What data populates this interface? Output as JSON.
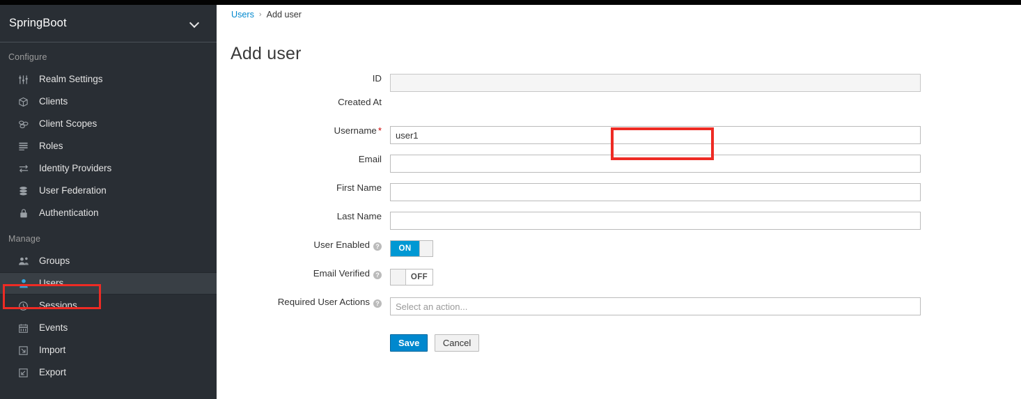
{
  "topbar": {
    "present": true
  },
  "sidebar": {
    "realm_name": "SpringBoot",
    "chevron_icon": "chevron-down-icon",
    "sections": [
      {
        "title": "Configure",
        "items": [
          {
            "label": "Realm Settings",
            "icon": "sliders-icon",
            "selected": false
          },
          {
            "label": "Clients",
            "icon": "cube-icon",
            "selected": false
          },
          {
            "label": "Client Scopes",
            "icon": "scopes-icon",
            "selected": false
          },
          {
            "label": "Roles",
            "icon": "list-icon",
            "selected": false
          },
          {
            "label": "Identity Providers",
            "icon": "exchange-arrows-icon",
            "selected": false
          },
          {
            "label": "User Federation",
            "icon": "database-icon",
            "selected": false
          },
          {
            "label": "Authentication",
            "icon": "lock-icon",
            "selected": false
          }
        ]
      },
      {
        "title": "Manage",
        "items": [
          {
            "label": "Groups",
            "icon": "users-group-icon",
            "selected": false
          },
          {
            "label": "Users",
            "icon": "user-icon",
            "selected": true
          },
          {
            "label": "Sessions",
            "icon": "clock-icon",
            "selected": false
          },
          {
            "label": "Events",
            "icon": "calendar-icon",
            "selected": false
          },
          {
            "label": "Import",
            "icon": "import-arrow-icon",
            "selected": false
          },
          {
            "label": "Export",
            "icon": "export-arrow-icon",
            "selected": false
          }
        ]
      }
    ]
  },
  "breadcrumb": {
    "parent": "Users",
    "separator": "›",
    "current": "Add user"
  },
  "page": {
    "title": "Add user"
  },
  "form": {
    "fields": {
      "id": {
        "label": "ID",
        "value": "",
        "placeholder": "",
        "disabled": true
      },
      "created_at": {
        "label": "Created At",
        "value": ""
      },
      "username": {
        "label": "Username",
        "required_marker": "*",
        "value": "user1",
        "placeholder": ""
      },
      "email": {
        "label": "Email",
        "value": "",
        "placeholder": ""
      },
      "first_name": {
        "label": "First Name",
        "value": "",
        "placeholder": ""
      },
      "last_name": {
        "label": "Last Name",
        "value": "",
        "placeholder": ""
      },
      "user_enabled": {
        "label": "User Enabled",
        "help": "?",
        "state": "ON"
      },
      "email_verified": {
        "label": "Email Verified",
        "help": "?",
        "state": "OFF"
      },
      "required_user_actions": {
        "label": "Required User Actions",
        "help": "?",
        "value": "",
        "placeholder": "Select an action..."
      }
    },
    "buttons": {
      "save": "Save",
      "cancel": "Cancel"
    }
  },
  "annotations": {
    "users_nav_box_color": "#ee2b24",
    "username_field_box_color": "#ee2b24"
  },
  "colors": {
    "sidebar_bg": "#292e34",
    "sidebar_selected_bg": "#393f45",
    "accent_blue": "#0088ce",
    "toggle_on_blue": "#0098d3",
    "link_blue": "#0088ce",
    "required_red": "#cc0000",
    "annotation_red": "#ee2b24"
  }
}
